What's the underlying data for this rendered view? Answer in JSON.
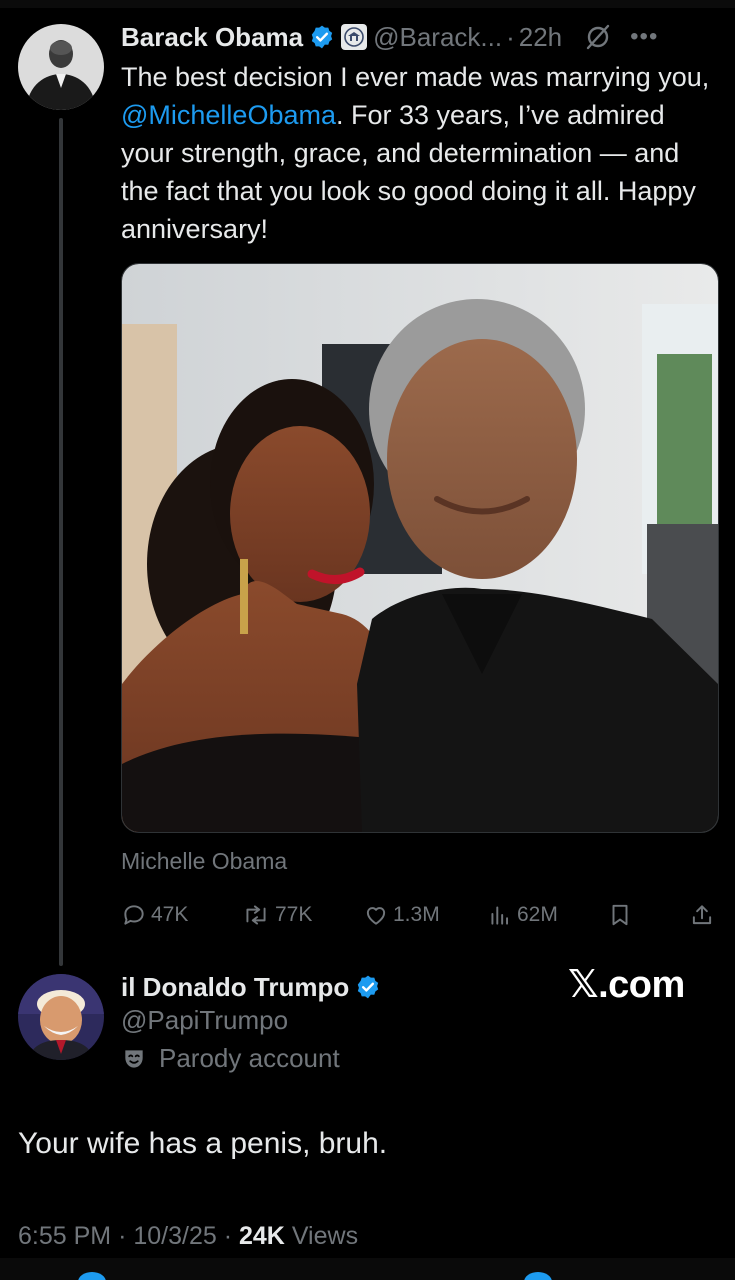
{
  "original_tweet": {
    "author_name": "Barack Obama",
    "handle": "@Barack...",
    "separator": "·",
    "time_ago": "22h",
    "text_before_mention": "The best decision I ever made was marrying you, ",
    "mention": "@MichelleObama",
    "text_after_mention": ". For 33 years, I’ve admired your strength, grace, and determination — and the fact that you look so good doing it all. Happy anniversary!",
    "tagged_person": "Michelle Obama",
    "stats": {
      "replies": "47K",
      "reposts": "77K",
      "likes": "1.3M",
      "views": "62M"
    },
    "icons": {
      "verified": "verified-badge-icon",
      "government": "government-seal-icon",
      "grok": "grok-icon",
      "more": "more-icon"
    }
  },
  "reply": {
    "author_name": "il Donaldo Trumpo",
    "handle": "@PapiTrumpo",
    "label": "Parody account",
    "text": "Your wife has a penis, bruh.",
    "time": "6:55 PM",
    "date": "10/3/25",
    "views_count": "24K",
    "views_label": "Views"
  },
  "watermark": "𝕏.com",
  "colors": {
    "background": "#000000",
    "text": "#e7e9ea",
    "secondary": "#71767b",
    "link": "#1d9bf0",
    "verified": "#1d9bf0"
  }
}
